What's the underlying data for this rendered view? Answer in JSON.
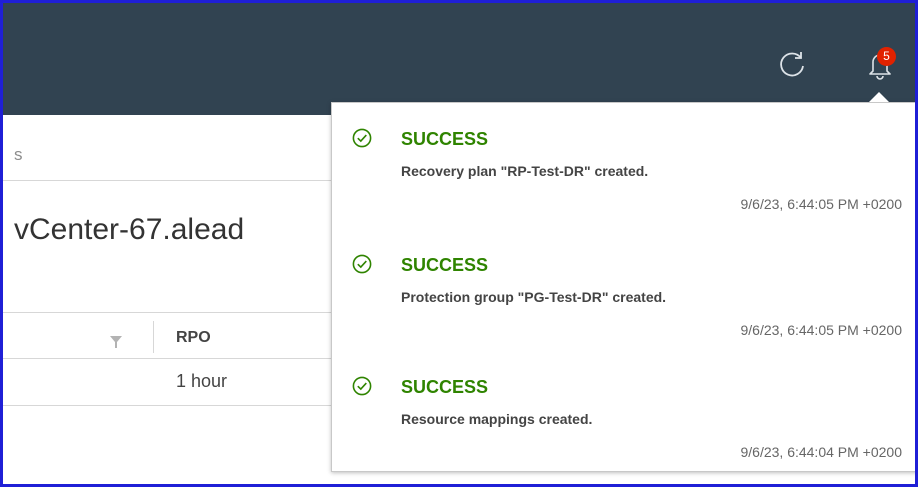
{
  "header": {
    "refresh_icon": "refresh-icon",
    "bell_icon": "bell-icon",
    "notification_count": "5"
  },
  "background": {
    "breadcrumb_fragment": "s",
    "page_title": "vCenter-67.alead",
    "table": {
      "column_rpo": "RPO",
      "rows": [
        {
          "rpo": "1 hour"
        }
      ]
    }
  },
  "notifications": [
    {
      "status": "SUCCESS",
      "message": "Recovery plan \"RP-Test-DR\" created.",
      "timestamp": "9/6/23, 6:44:05 PM +0200"
    },
    {
      "status": "SUCCESS",
      "message": "Protection group \"PG-Test-DR\" created.",
      "timestamp": "9/6/23, 6:44:05 PM +0200"
    },
    {
      "status": "SUCCESS",
      "message": "Resource mappings created.",
      "timestamp": "9/6/23, 6:44:04 PM +0200"
    }
  ],
  "colors": {
    "header_bg": "#314351",
    "success_green": "#2f8400",
    "badge_red": "#e12200"
  }
}
